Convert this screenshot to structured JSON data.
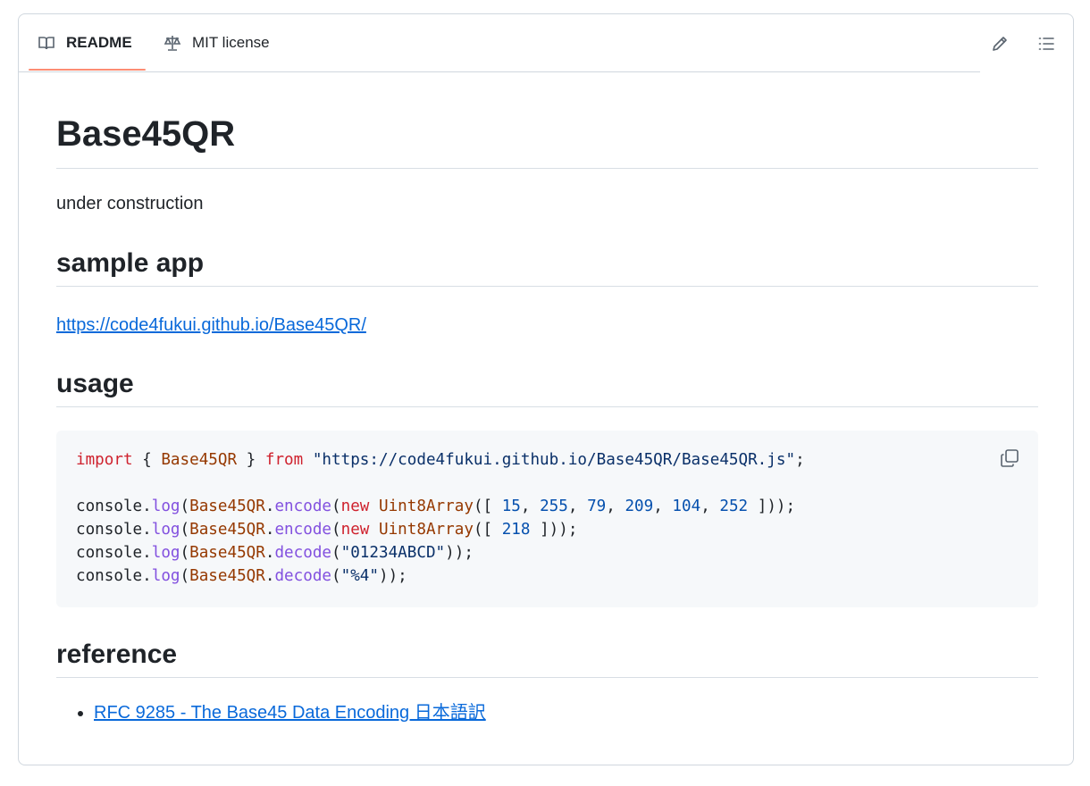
{
  "tabs": [
    {
      "label": "README",
      "icon": "book-icon",
      "active": true
    },
    {
      "label": "MIT license",
      "icon": "scale-icon",
      "active": false
    }
  ],
  "toolbar": {
    "edit_icon": "pencil-icon",
    "outline_icon": "list-icon"
  },
  "readme": {
    "title": "Base45QR",
    "intro": "under construction",
    "sample_heading": "sample app",
    "sample_link": "https://code4fukui.github.io/Base45QR/",
    "usage_heading": "usage",
    "code": {
      "line1": {
        "k1": "import",
        "p1": " { ",
        "c1": "Base45QR",
        "p2": " } ",
        "k2": "from",
        "p3": " ",
        "s1": "\"https://code4fukui.github.io/Base45QR/Base45QR.js\"",
        "p4": ";"
      },
      "line2": {
        "o": "console.",
        "f1": "log",
        "p1": "(",
        "c1": "Base45QR",
        "p2": ".",
        "f2": "encode",
        "p3": "(",
        "k1": "new",
        "p4": " ",
        "c2": "Uint8Array",
        "p5": "([ ",
        "n1": "15",
        "s1": ", ",
        "n2": "255",
        "s2": ", ",
        "n3": "79",
        "s3": ", ",
        "n4": "209",
        "s4": ", ",
        "n5": "104",
        "s5": ", ",
        "n6": "252",
        "p6": " ]));"
      },
      "line3": {
        "o": "console.",
        "f1": "log",
        "p1": "(",
        "c1": "Base45QR",
        "p2": ".",
        "f2": "encode",
        "p3": "(",
        "k1": "new",
        "p4": " ",
        "c2": "Uint8Array",
        "p5": "([ ",
        "n1": "218",
        "p6": " ]));"
      },
      "line4": {
        "o": "console.",
        "f1": "log",
        "p1": "(",
        "c1": "Base45QR",
        "p2": ".",
        "f2": "decode",
        "p3": "(",
        "s1": "\"01234ABCD\"",
        "p4": "));"
      },
      "line5": {
        "o": "console.",
        "f1": "log",
        "p1": "(",
        "c1": "Base45QR",
        "p2": ".",
        "f2": "decode",
        "p3": "(",
        "s1": "\"%4\"",
        "p4": "));"
      }
    },
    "copy_icon": "copy-icon",
    "reference_heading": "reference",
    "references": [
      {
        "label": "RFC 9285 - The Base45 Data Encoding 日本語訳"
      }
    ]
  },
  "colors": {
    "accent_underline": "#fd8c73",
    "link": "#0969da",
    "code_bg": "#f6f8fa"
  }
}
